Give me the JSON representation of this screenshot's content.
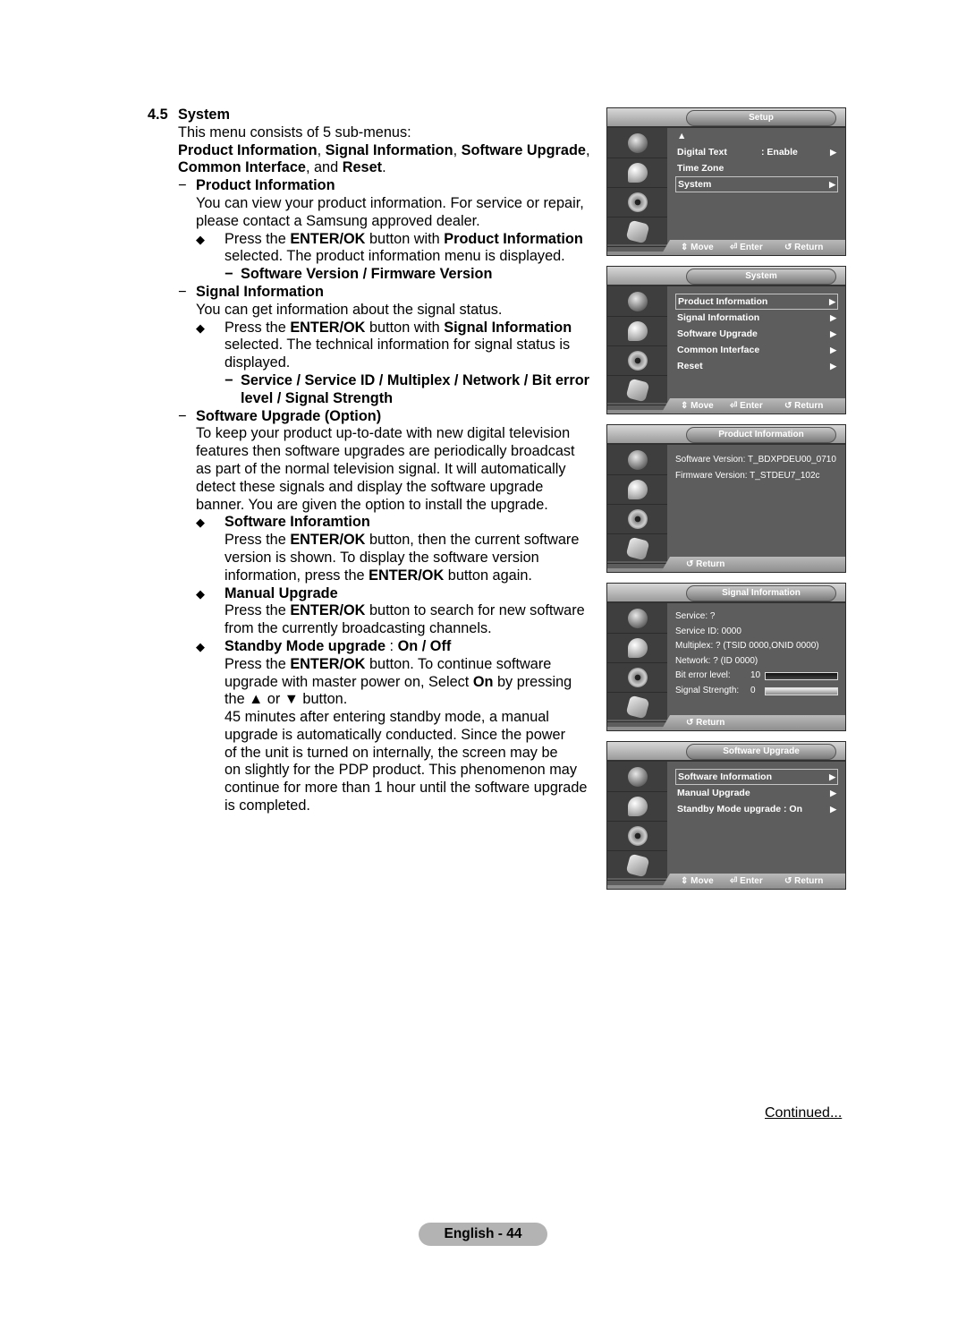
{
  "section": {
    "number": "4.5",
    "title": "System",
    "intro": "This menu consists of 5 sub-menus:",
    "submenus_line1": [
      {
        "text": "Product Information",
        "bold": true
      },
      {
        "text": ", ",
        "bold": false
      },
      {
        "text": "Signal Information",
        "bold": true
      },
      {
        "text": ", ",
        "bold": false
      },
      {
        "text": "Software Upgrade",
        "bold": true
      },
      {
        "text": ",",
        "bold": false
      }
    ],
    "submenus_line2": [
      {
        "text": "Common Interface",
        "bold": true
      },
      {
        "text": ", and ",
        "bold": false
      },
      {
        "text": "Reset",
        "bold": true
      },
      {
        "text": ".",
        "bold": false
      }
    ]
  },
  "product_info": {
    "dash": "−",
    "heading": "Product Information",
    "desc_lines": [
      "You can view your product information. For service or repair,",
      "please contact a Samsung approved dealer."
    ],
    "bullet": "◆",
    "press_pre": "Press the ",
    "press_key": "ENTER/OK",
    "press_mid": " button with ",
    "press_item": "Product Information",
    "press_line2": "selected. The product information menu is displayed.",
    "sub_dash": "−",
    "sub_items": "Software Version / Firmware Version"
  },
  "signal_info": {
    "dash": "−",
    "heading": "Signal Information",
    "desc": "You can get information about the signal status.",
    "bullet": "◆",
    "press_pre": "Press the ",
    "press_key": "ENTER/OK",
    "press_mid": " button with ",
    "press_item": "Signal Information",
    "press_line2": "selected. The technical information for signal status is",
    "press_line3": "displayed.",
    "sub_dash": "−",
    "sub_items_line1": "Service / Service ID / Multiplex / Network / Bit error",
    "sub_items_line2": "level / Signal Strength"
  },
  "software_upgrade": {
    "dash": "−",
    "heading": "Software Upgrade (Option)",
    "desc_lines": [
      "To keep your product up-to-date with new digital television",
      "features then software upgrades are periodically broadcast",
      "as part of the normal television signal. It will automatically",
      "detect these signals and display the software upgrade",
      "banner. You are given the option to install the upgrade."
    ],
    "bullet": "◆",
    "sw_info": {
      "heading": "Software Inforamtion",
      "l1_pre": "Press the ",
      "l1_key": "ENTER/OK",
      "l1_post": " button, then the current software",
      "l2": "version is shown. To display the software version",
      "l3_pre": "information, press the ",
      "l3_key": "ENTER/OK",
      "l3_post": " button again."
    },
    "manual": {
      "heading": "Manual Upgrade",
      "l1_pre": "Press the ",
      "l1_key": "ENTER/OK",
      "l1_post": " button to search for new software",
      "l2": "from the currently broadcasting channels."
    },
    "standby": {
      "heading_pre": "Standby Mode upgrade",
      "heading_sep": " : ",
      "heading_opts": "On / Off",
      "l1_pre": "Press the ",
      "l1_key": "ENTER/OK",
      "l1_post": " button. To continue software",
      "l2_pre": "upgrade with master power on, Select ",
      "l2_key": "On",
      "l2_post": " by pressing",
      "l3": "the ▲ or ▼ button.",
      "extra_lines": [
        "45 minutes after entering standby mode, a manual",
        "upgrade is automatically conducted. Since the power",
        "of the unit is turned on internally, the screen may be",
        "on slightly for the PDP product. This phenomenon may",
        "continue for more than 1 hour until the software upgrade",
        "is completed."
      ]
    }
  },
  "osd_common": {
    "side_icons": [
      "globe-icon",
      "satellite-dish-icon",
      "gear-icon",
      "input-key-icon"
    ],
    "move": "Move",
    "enter": "Enter",
    "return": "Return",
    "move_glyph": "⇕",
    "enter_glyph": "⏎",
    "return_glyph": "↺",
    "arrow_glyph": "▶",
    "up_glyph": "▲"
  },
  "osd_setup": {
    "title": "Setup",
    "items": [
      {
        "label": "Digital Text",
        "value": ": Enable",
        "arrow": true,
        "selected": false
      },
      {
        "label": "Time Zone",
        "value": "",
        "arrow": false,
        "selected": false
      },
      {
        "label": "System",
        "value": "",
        "arrow": true,
        "selected": true
      }
    ]
  },
  "osd_system": {
    "title": "System",
    "items": [
      {
        "label": "Product Information",
        "selected": true
      },
      {
        "label": "Signal Information",
        "selected": false
      },
      {
        "label": "Software Upgrade",
        "selected": false
      },
      {
        "label": "Common Interface",
        "selected": false
      },
      {
        "label": "Reset",
        "selected": false
      }
    ]
  },
  "osd_product": {
    "title": "Product Information",
    "lines": [
      "Software Version: T_BDXPDEU00_0710",
      "Firmware Version: T_STDEU7_102c"
    ]
  },
  "osd_signal": {
    "title": "Signal Information",
    "lines": [
      "Service: ?",
      "Service ID: 0000",
      "Multiplex: ? (TSID 0000,ONID 0000)",
      "Network: ? (ID 0000)"
    ],
    "bit_error": {
      "label": "Bit error level:",
      "value": "10",
      "fill_fraction": 1.0
    },
    "signal_strength": {
      "label": "Signal Strength:",
      "value": "0",
      "fill_fraction": 0.0
    }
  },
  "osd_swupgrade": {
    "title": "Software Upgrade",
    "items": [
      {
        "label": "Software Information",
        "selected": true
      },
      {
        "label": "Manual Upgrade",
        "selected": false
      },
      {
        "label": "Standby Mode upgrade : On",
        "selected": false
      }
    ]
  },
  "footer": {
    "continued": "Continued...",
    "page_label": "English - 44"
  }
}
